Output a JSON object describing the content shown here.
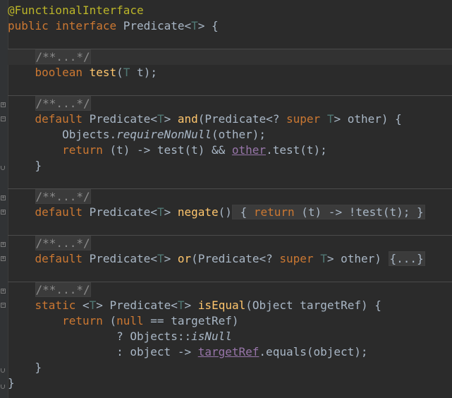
{
  "code": {
    "annotation": "@FunctionalInterface",
    "kw_public": "public",
    "kw_interface": "interface",
    "iface_name": "Predicate",
    "lt": "<",
    "gt": ">",
    "T": "T",
    "open_brace": " {",
    "close_brace": "}",
    "folded_doc": "/**...*/",
    "kw_boolean": "boolean",
    "m_test": "test",
    "test_params_open": "(",
    "test_params_rest": " t);",
    "kw_default": "default",
    "m_and": "and",
    "and_param": "(Predicate<? ",
    "kw_super": "super",
    "other_param": "> other) {",
    "objects": "Objects.",
    "require_non_null": "requireNonNull",
    "require_args": "(other);",
    "kw_return": "return",
    "and_lambda": " (t) -> test(t) && ",
    "other_field": "other",
    "and_tail": ".test(t);",
    "m_negate": "negate",
    "negate_parens": "()",
    "negate_body_open": " { ",
    "negate_lambda": " (t) -> !test(t);",
    "negate_body_close": " }",
    "m_or": "or",
    "or_param_tail": "> other) ",
    "folded_body": "{...}",
    "kw_static": "static",
    "m_is_equal": "isEqual",
    "is_equal_params": "(Object targetRef) {",
    "kw_null": "null",
    "is_equal_return_open": " (",
    "is_equal_cond": " == targetRef)",
    "ternary_q": "? Objects::",
    "is_null": "isNull",
    "ternary_colon": ": object -> ",
    "target_ref_field": "targetRef",
    "equals_tail": ".equals(object);"
  }
}
